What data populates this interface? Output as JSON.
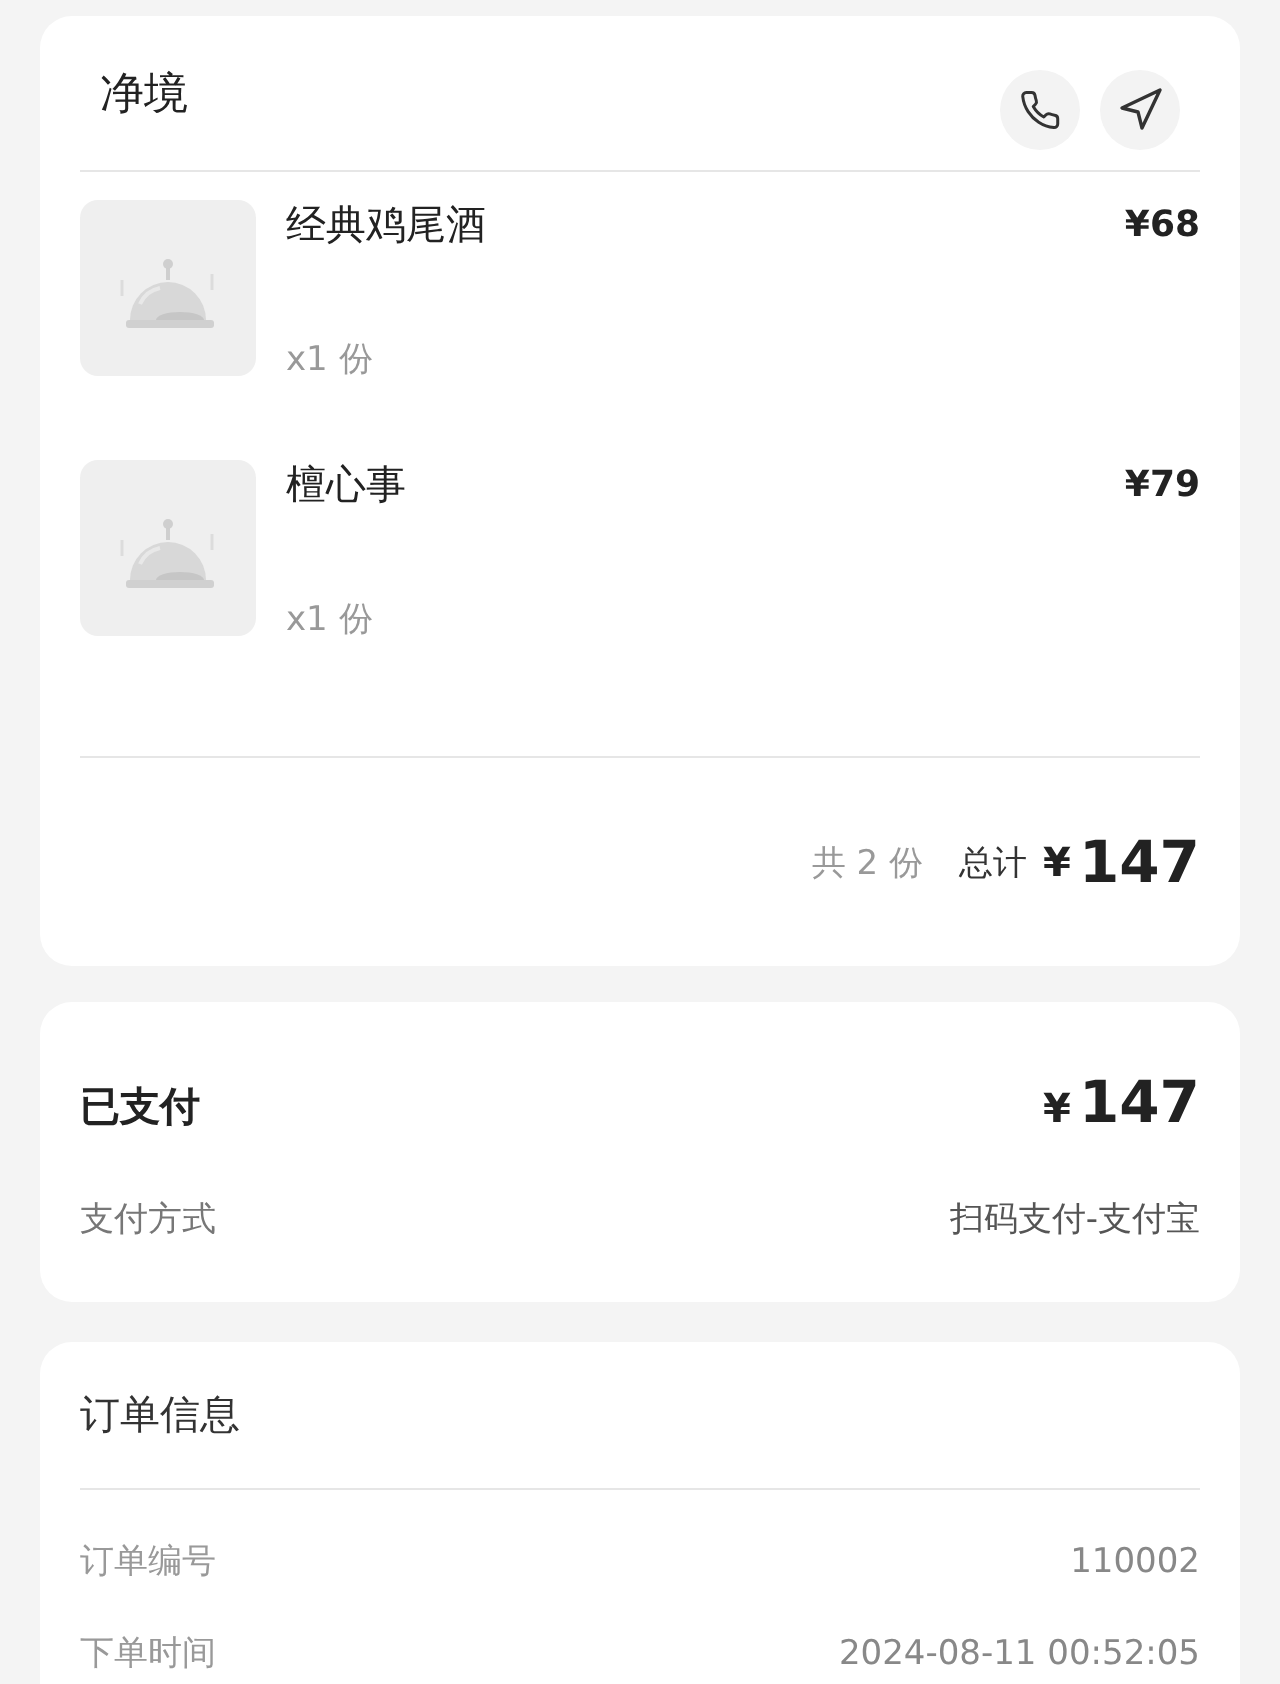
{
  "store": {
    "name": "净境"
  },
  "items": [
    {
      "name": "经典鸡尾酒",
      "price": "¥68",
      "quantity": "x1 份"
    },
    {
      "name": "檀心事",
      "price": "¥79",
      "quantity": "x1 份"
    }
  ],
  "summary": {
    "count": "共 2 份",
    "total_label": "总计",
    "currency": "¥",
    "total": "147"
  },
  "payment": {
    "status": "已支付",
    "currency": "¥",
    "amount": "147",
    "method_label": "支付方式",
    "method": "扫码支付-支付宝"
  },
  "order_info": {
    "title": "订单信息",
    "fields": [
      {
        "label": "订单编号",
        "value": "110002"
      },
      {
        "label": "下单时间",
        "value": "2024-08-11 00:52:05"
      }
    ]
  }
}
